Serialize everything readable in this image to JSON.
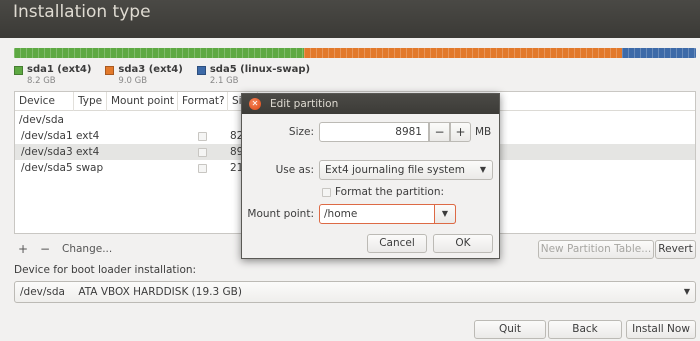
{
  "window": {
    "title": "Installation type"
  },
  "colors": {
    "ext4_green": "#5ea943",
    "ext4_orange": "#e2792b",
    "swap_blue": "#3d6aa8",
    "free": "#e6e4e1",
    "accent": "#dd4814"
  },
  "disk_bar": [
    {
      "name": "sda1",
      "fraction": 0.425,
      "color": "#5ea943"
    },
    {
      "name": "sda3",
      "fraction": 0.466,
      "color": "#e2792b"
    },
    {
      "name": "sda5",
      "fraction": 0.109,
      "color": "#3d6aa8"
    }
  ],
  "legend": [
    {
      "name": "sda1 (ext4)",
      "size": "8.2 GB",
      "color": "#5ea943"
    },
    {
      "name": "sda3 (ext4)",
      "size": "9.0 GB",
      "color": "#e2792b"
    },
    {
      "name": "sda5 (linux-swap)",
      "size": "2.1 GB",
      "color": "#3d6aa8"
    }
  ],
  "table": {
    "columns": [
      "Device",
      "Type",
      "Mount point",
      "Format?",
      "Si"
    ],
    "rows": [
      {
        "device": "/dev/sda",
        "type": "",
        "mount": "",
        "format": null,
        "size": ""
      },
      {
        "device": "/dev/sda1",
        "type": "ext4",
        "mount": "",
        "format": false,
        "size": "82"
      },
      {
        "device": "/dev/sda3",
        "type": "ext4",
        "mount": "",
        "format": false,
        "size": "89",
        "selected": true
      },
      {
        "device": "/dev/sda5",
        "type": "swap",
        "mount": "",
        "format": false,
        "size": "21"
      }
    ]
  },
  "toolbar": {
    "add_icon": "plus-icon",
    "add_label": "+",
    "remove_icon": "minus-icon",
    "remove_label": "−",
    "change_label": "Change...",
    "new_table_label": "New Partition Table...",
    "revert_label": "Revert"
  },
  "boot": {
    "label": "Device for boot loader installation:",
    "device": "/dev/sda",
    "description": "ATA VBOX HARDDISK (19.3 GB)",
    "arrow": "▼"
  },
  "actions": {
    "quit": "Quit",
    "back": "Back",
    "install": "Install Now"
  },
  "dialog": {
    "title": "Edit partition",
    "close_icon": "close-icon",
    "close_glyph": "✕",
    "size_label": "Size:",
    "size_value": "8981",
    "size_unit": "MB",
    "minus": "−",
    "plus": "+",
    "use_as_label": "Use as:",
    "use_as_value": "Ext4 journaling file system",
    "format_label": "Format the partition:",
    "format_checked": false,
    "mount_label": "Mount point:",
    "mount_value": "/home",
    "cancel": "Cancel",
    "ok": "OK",
    "arrow": "▼"
  }
}
